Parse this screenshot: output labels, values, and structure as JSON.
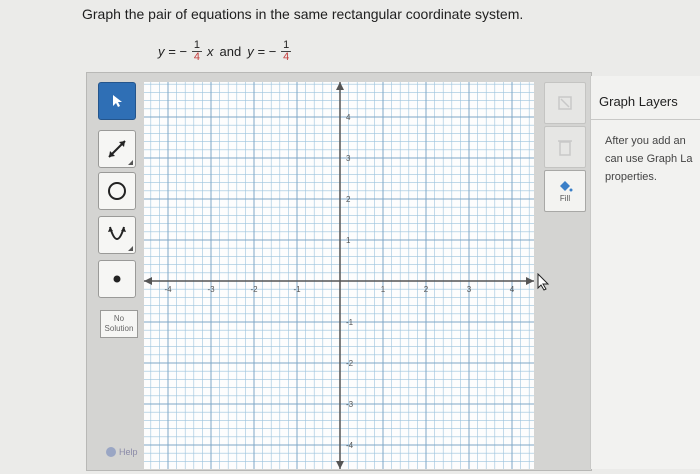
{
  "question": {
    "text": "Graph the pair of equations in the same rectangular coordinate system.",
    "eq1": {
      "lhs": "y = −",
      "num": "1",
      "den": "4",
      "var": "x"
    },
    "joiner": "and",
    "eq2": {
      "lhs": "y = −",
      "num": "1",
      "den": "4"
    }
  },
  "toolbar": {
    "tools": [
      {
        "name": "select",
        "icon": "pointer-icon",
        "selected": true
      },
      {
        "name": "line",
        "icon": "line-icon"
      },
      {
        "name": "circle",
        "icon": "circle-icon"
      },
      {
        "name": "parabola",
        "icon": "parabola-icon"
      },
      {
        "name": "point",
        "icon": "point-icon"
      }
    ],
    "no_solution_label": "No Solution",
    "help_label": "Help"
  },
  "graph": {
    "x_range": [
      -4,
      4
    ],
    "y_range": [
      -4,
      4
    ],
    "x_ticks": [
      "-4",
      "-3",
      "-2",
      "-1",
      "1",
      "2",
      "3",
      "4"
    ],
    "y_ticks": [
      "4",
      "3",
      "2",
      "1",
      "-1",
      "-2",
      "-3",
      "-4"
    ],
    "grid_minor_per_unit": 5
  },
  "rightbar": {
    "fill_label": "Fill",
    "accent": "#2f6fb5"
  },
  "layers": {
    "title": "Graph Layers",
    "body_lines": [
      "After you add an",
      "can use Graph La",
      "properties."
    ]
  }
}
